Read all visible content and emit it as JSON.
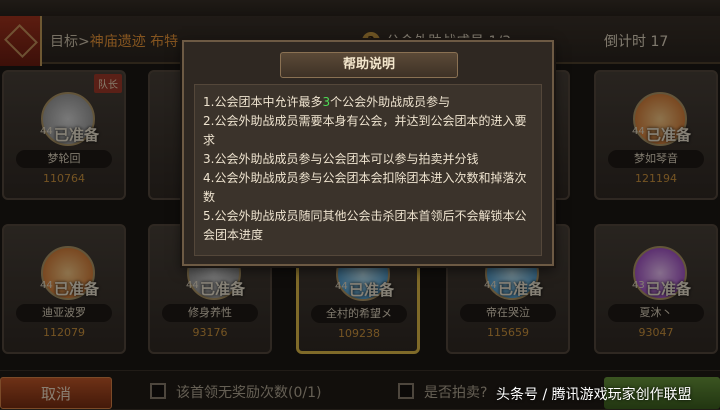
{
  "header": {
    "target_label": "目标>",
    "target_value": "神庙遗迹 布特",
    "helpers": "公会外助战成员 1/3",
    "countdown": "倒计时 17"
  },
  "captain_tag": "队长",
  "members": [
    {
      "level": "44",
      "status": "已准备",
      "name": "梦轮回",
      "power": "110764",
      "avatar": "white-swirl-avatar"
    },
    {
      "level": "",
      "status": "",
      "name": "",
      "power": "",
      "avatar": "orange-avatar"
    },
    {
      "level": "",
      "status": "",
      "name": "",
      "power": "",
      "avatar": "orange-avatar"
    },
    {
      "level": "",
      "status": "",
      "name": "",
      "power": "",
      "avatar": "orange-avatar"
    },
    {
      "level": "44",
      "status": "已准备",
      "name": "梦如琴音",
      "power": "121194",
      "avatar": "shield-avatar"
    },
    {
      "level": "44",
      "status": "已准备",
      "name": "迪亚波罗",
      "power": "112079",
      "avatar": "key-avatar"
    },
    {
      "level": "44",
      "status": "已准备",
      "name": "修身养性",
      "power": "93176",
      "avatar": "white-avatar"
    },
    {
      "level": "44",
      "status": "已准备",
      "name": "全村的希望メ",
      "power": "109238",
      "avatar": "blue-avatar"
    },
    {
      "level": "44",
      "status": "已准备",
      "name": "帝在哭泣",
      "power": "115659",
      "avatar": "blue-red-avatar"
    },
    {
      "level": "43",
      "status": "已准备",
      "name": "夏沐丶",
      "power": "93047",
      "avatar": "skull-avatar"
    }
  ],
  "footer": {
    "cancel_label": "取消",
    "no_reward_label": "该首领无奖励次数(0/1)",
    "auction_label": "是否拍卖?"
  },
  "dialog": {
    "title": "帮助说明",
    "line1_pre": "1.公会团本中允许最多",
    "line1_num": "3",
    "line1_post": "个公会外助战成员参与",
    "line2": "2.公会外助战成员需要本身有公会，并达到公会团本的进入要求",
    "line3": "3.公会外助战成员参与公会团本可以参与拍卖并分钱",
    "line4": "4.公会外助战成员参与公会团本会扣除团本进入次数和掉落次数",
    "line5": "5.公会外助战成员随同其他公会击杀团本首领后不会解锁本公会团本进度"
  },
  "watermark": "头条号 / 腾讯游戏玩家创作联盟",
  "colors": {
    "highlight": "#4ddb55",
    "accent_orange": "#f09a3a",
    "power": "#d69a40",
    "selected_border": "#e8c24b"
  }
}
